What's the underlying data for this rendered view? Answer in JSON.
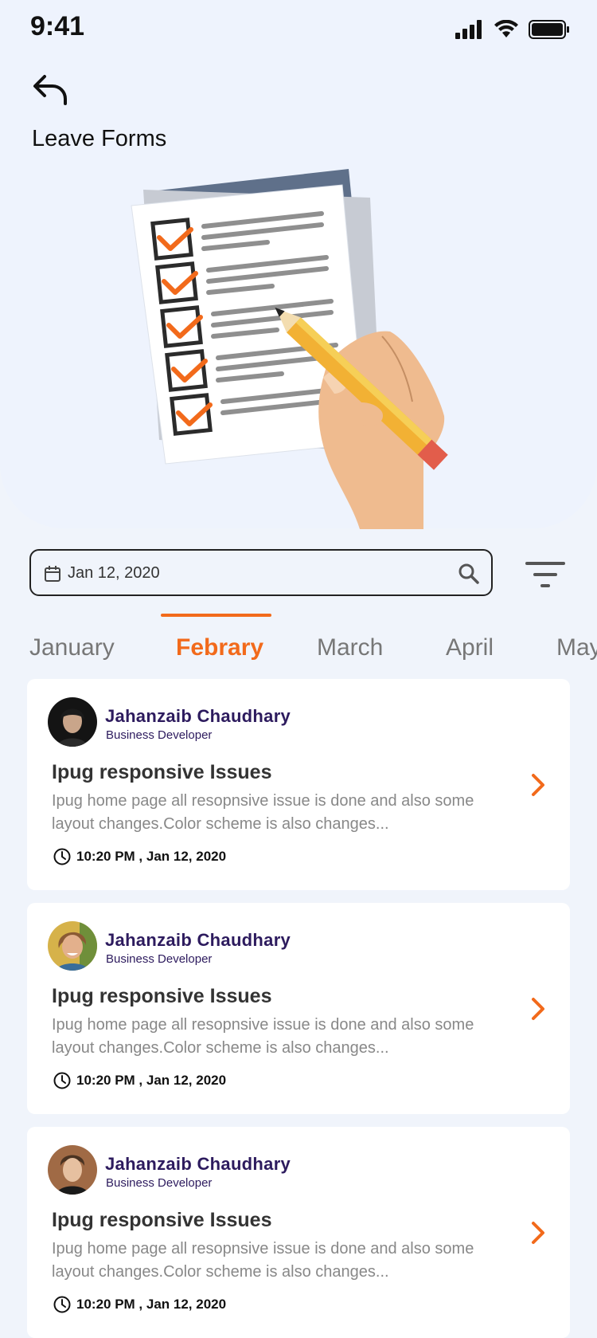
{
  "status_bar": {
    "time": "9:41"
  },
  "header": {
    "title": "Leave Forms"
  },
  "search": {
    "date_value": "Jan 12, 2020"
  },
  "months": [
    "January",
    "Febrary",
    "March",
    "April",
    "May"
  ],
  "active_month": "Febrary",
  "cards": [
    {
      "name": "Jahanzaib Chaudhary",
      "role": "Business Developer",
      "subject": "Ipug responsive Issues",
      "description": "Ipug home page all resopnsive issue is done and also some layout changes.Color scheme is also changes...",
      "datetime": "10:20 PM , Jan 12, 2020"
    },
    {
      "name": "Jahanzaib Chaudhary",
      "role": "Business Developer",
      "subject": "Ipug responsive Issues",
      "description": "Ipug home page all resopnsive issue is done and also some layout changes.Color scheme is also changes...",
      "datetime": "10:20 PM , Jan 12, 2020"
    },
    {
      "name": "Jahanzaib Chaudhary",
      "role": "Business Developer",
      "subject": "Ipug responsive Issues",
      "description": "Ipug home page all resopnsive issue is done and also some layout changes.Color scheme is also changes...",
      "datetime": "10:20 PM , Jan 12, 2020"
    }
  ],
  "colors": {
    "accent": "#f26a1b",
    "name": "#2d1b5e",
    "background": "#f0f4fb"
  },
  "icons": [
    "back-arrow-icon",
    "calendar-icon",
    "search-icon",
    "filter-icon",
    "clock-icon",
    "chevron-right-icon"
  ]
}
